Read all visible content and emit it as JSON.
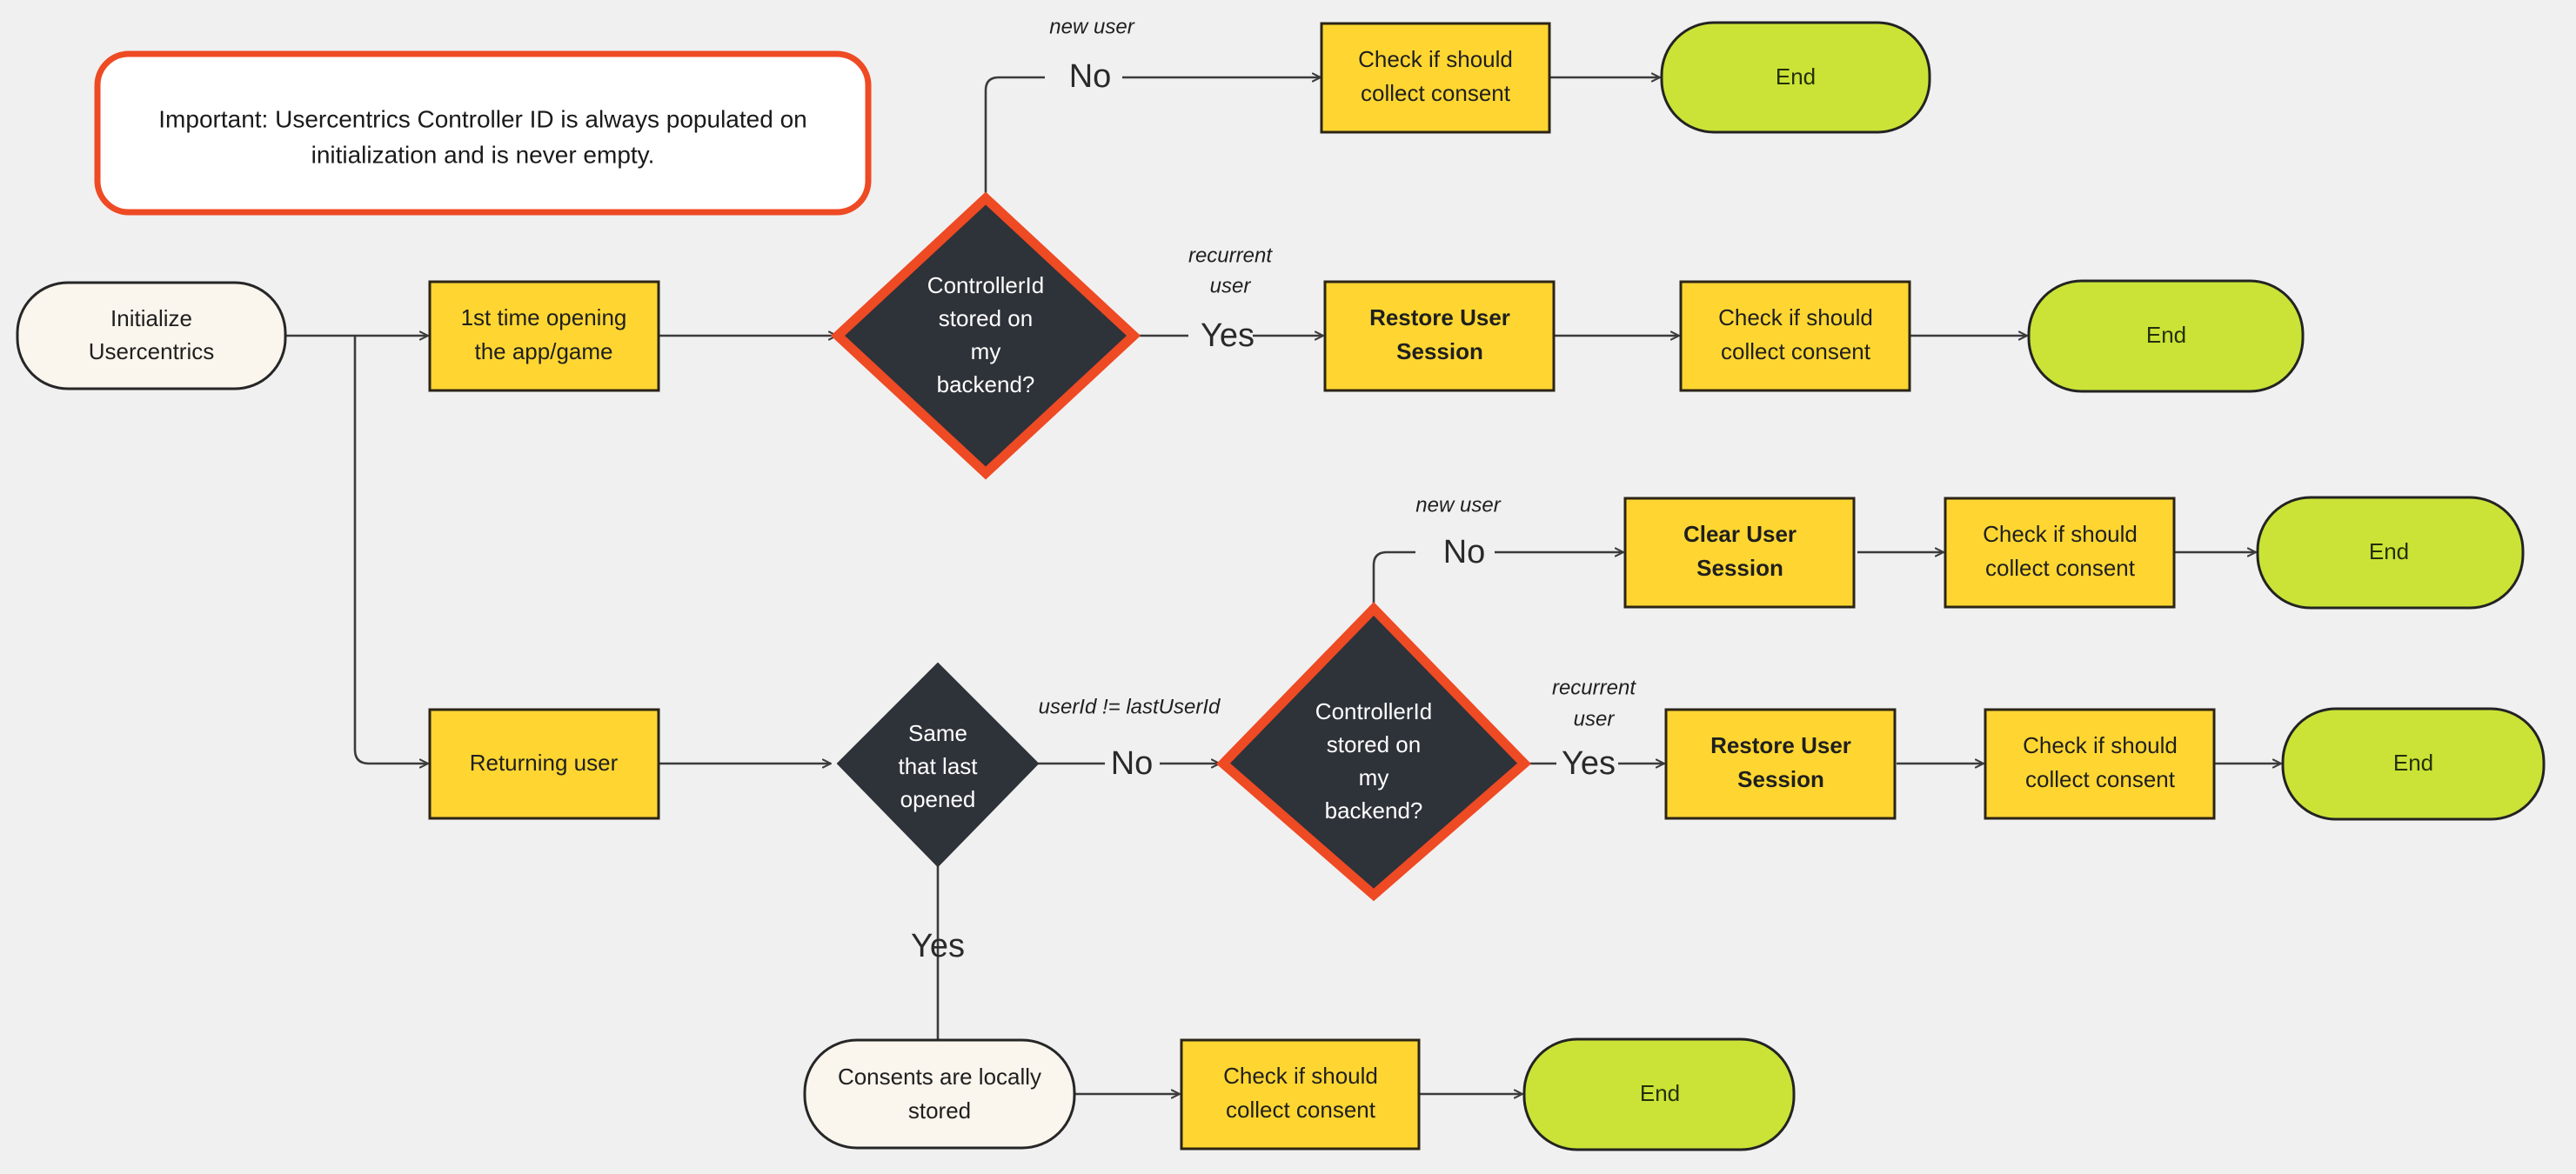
{
  "diagram": {
    "title": "Usercentrics Controller ID initialization flow",
    "background_color": "#f0f0f0",
    "colors": {
      "yellow_fill": "#ffd631",
      "green_fill": "#cbe337",
      "cream_fill": "#faf5ed",
      "dark_fill": "#2e3239",
      "accent_orange": "#ee4a24",
      "edge_stroke": "#3b3b3b",
      "text_dark": "#1f1f1f",
      "text_light": "#ffffff"
    }
  },
  "callout": {
    "name": "important-note",
    "line1": "Important: Usercentrics Controller ID is always populated on",
    "line2": "initialization and is never empty."
  },
  "nodes": {
    "start": {
      "label_line1": "Initialize",
      "label_line2": "Usercentrics",
      "shape": "pill",
      "fill": "cream"
    },
    "first_time": {
      "label_line1": "1st time opening",
      "label_line2": "the app/game",
      "shape": "rect",
      "fill": "yellow"
    },
    "returning_user": {
      "label_line1": "Returning user",
      "shape": "rect",
      "fill": "yellow"
    },
    "decision_backend_top": {
      "label_line1": "ControllerId",
      "label_line2": "stored on",
      "label_line3": "my",
      "label_line4": "backend?",
      "shape": "diamond",
      "fill": "dark",
      "border": "orange"
    },
    "decision_backend_mid": {
      "label_line1": "ControllerId",
      "label_line2": "stored on",
      "label_line3": "my",
      "label_line4": "backend?",
      "shape": "diamond",
      "fill": "dark",
      "border": "orange"
    },
    "decision_same_opened": {
      "label_line1": "Same",
      "label_line2": "that last",
      "label_line3": "opened",
      "shape": "diamond",
      "fill": "dark"
    },
    "check_consent_top": {
      "label_line1": "Check if should",
      "label_line2": "collect consent",
      "shape": "rect",
      "fill": "yellow"
    },
    "check_consent_row2": {
      "label_line1": "Check if should",
      "label_line2": "collect consent",
      "shape": "rect",
      "fill": "yellow"
    },
    "check_consent_row3": {
      "label_line1": "Check if should",
      "label_line2": "collect consent",
      "shape": "rect",
      "fill": "yellow"
    },
    "check_consent_row4": {
      "label_line1": "Check if should",
      "label_line2": "collect consent",
      "shape": "rect",
      "fill": "yellow"
    },
    "check_consent_row5": {
      "label_line1": "Check if should",
      "label_line2": "collect consent",
      "shape": "rect",
      "fill": "yellow"
    },
    "restore_session_row2": {
      "label_line1": "Restore User",
      "label_line2": "Session",
      "shape": "rect",
      "fill": "yellow",
      "bold": true
    },
    "restore_session_row4": {
      "label_line1": "Restore User",
      "label_line2": "Session",
      "shape": "rect",
      "fill": "yellow",
      "bold": true
    },
    "clear_session": {
      "label_line1": "Clear User",
      "label_line2": "Session",
      "shape": "rect",
      "fill": "yellow",
      "bold": true
    },
    "consents_local": {
      "label_line1": "Consents are locally",
      "label_line2": "stored",
      "shape": "pill",
      "fill": "cream"
    },
    "end_top": {
      "label_line1": "End",
      "shape": "pill",
      "fill": "green"
    },
    "end_row2": {
      "label_line1": "End",
      "shape": "pill",
      "fill": "green"
    },
    "end_row3": {
      "label_line1": "End",
      "shape": "pill",
      "fill": "green"
    },
    "end_row4": {
      "label_line1": "End",
      "shape": "pill",
      "fill": "green"
    },
    "end_row5": {
      "label_line1": "End",
      "shape": "pill",
      "fill": "green"
    }
  },
  "edge_labels": {
    "top_no": "No",
    "top_new_user": "new user",
    "mid_yes": "Yes",
    "mid_recurrent_user_l1": "recurrent",
    "mid_recurrent_user_l2": "user",
    "row3_no": "No",
    "row3_new_user": "new user",
    "row4_yes": "Yes",
    "row4_recurrent_user_l1": "recurrent",
    "row4_recurrent_user_l2": "user",
    "same_no": "No",
    "same_userid_cond": "userId != lastUserId",
    "same_yes": "Yes"
  }
}
